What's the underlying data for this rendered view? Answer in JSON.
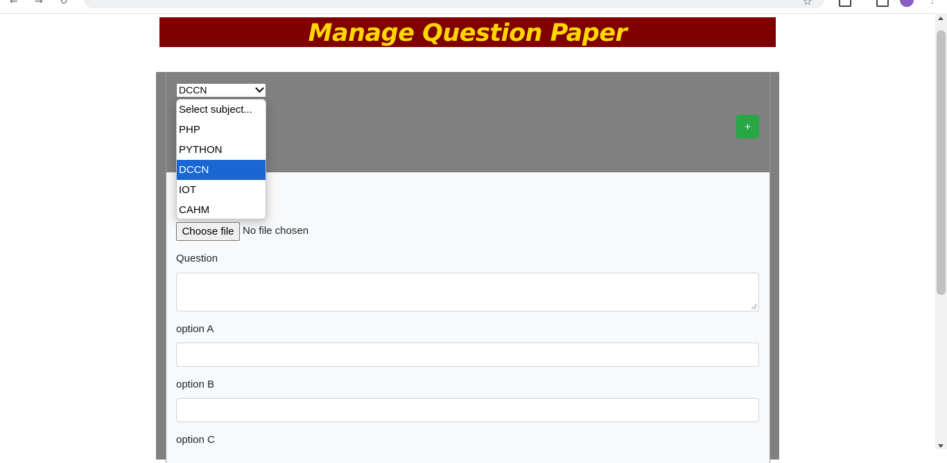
{
  "header": {
    "title": "Manage Question Paper"
  },
  "subject_select": {
    "selected": "DCCN",
    "options": [
      "Select subject...",
      "PHP",
      "PYTHON",
      "DCCN",
      "IOT",
      "CAHM"
    ]
  },
  "add_button": {
    "label": "+"
  },
  "file_input": {
    "button_label": "Choose file",
    "status": "No file chosen"
  },
  "form": {
    "question_label": "Question",
    "option_a_label": "option A",
    "option_b_label": "option B",
    "option_c_label": "option C"
  },
  "colors": {
    "header_bg": "#800000",
    "header_text": "#ffd700",
    "add_button": "#28a745",
    "selected_option": "#1a66d2"
  }
}
